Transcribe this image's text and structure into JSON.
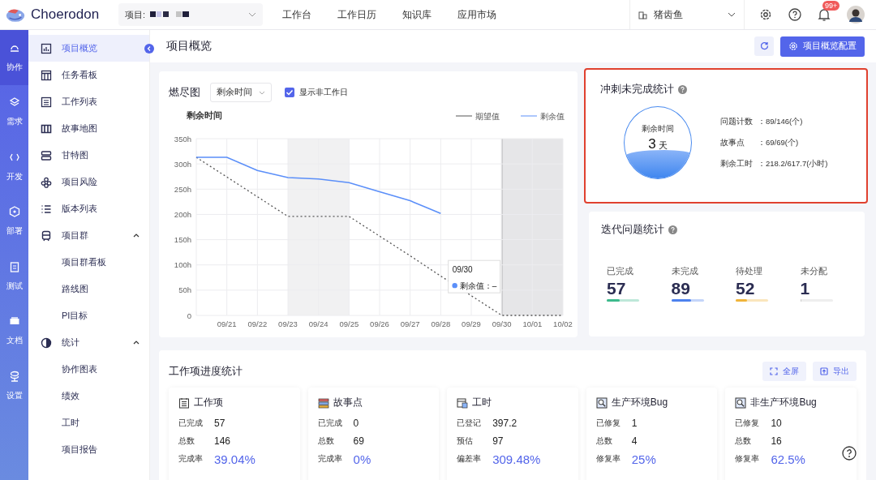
{
  "topbar": {
    "brand": "Choerodon",
    "project_label": "项目:",
    "nav": [
      {
        "label": "工作台"
      },
      {
        "label": "工作日历"
      },
      {
        "label": "知识库"
      },
      {
        "label": "应用市场"
      }
    ],
    "org": "猪齿鱼",
    "notification_count": "99+"
  },
  "rail": [
    {
      "label": "协作",
      "selected": true
    },
    {
      "label": "需求",
      "selected": false
    },
    {
      "label": "开发",
      "selected": false
    },
    {
      "label": "部署",
      "selected": false
    },
    {
      "label": "测试",
      "selected": false
    },
    {
      "label": "文档",
      "selected": false
    },
    {
      "label": "设置",
      "selected": false
    }
  ],
  "sidebar": {
    "items": [
      {
        "label": "项目概览",
        "selected": true
      },
      {
        "label": "任务看板",
        "selected": false
      },
      {
        "label": "工作列表",
        "selected": false
      },
      {
        "label": "故事地图",
        "selected": false
      },
      {
        "label": "甘特图",
        "selected": false
      },
      {
        "label": "项目风险",
        "selected": false
      },
      {
        "label": "版本列表",
        "selected": false
      },
      {
        "label": "项目群",
        "selected": false,
        "expanded": true,
        "children": [
          {
            "label": "项目群看板",
            "selected": false
          },
          {
            "label": "路线图",
            "selected": false
          },
          {
            "label": "PI目标",
            "selected": false
          }
        ]
      },
      {
        "label": "统计",
        "selected": false,
        "expanded": true,
        "children": [
          {
            "label": "协作图表",
            "selected": false
          },
          {
            "label": "绩效",
            "selected": false
          },
          {
            "label": "工时",
            "selected": false
          },
          {
            "label": "项目报告",
            "selected": false
          }
        ]
      }
    ]
  },
  "page": {
    "title": "项目概览",
    "config_button": "项目概览配置"
  },
  "burndown": {
    "title": "燃尽图",
    "select_value": "剩余时间",
    "show_nonworking": {
      "label": "显示非工作日",
      "checked": true
    },
    "chart_data": {
      "type": "line",
      "ylabel": "剩余时间",
      "categories": [
        null,
        "09/21",
        "09/22",
        "09/23",
        "09/24",
        "09/25",
        "09/26",
        "09/27",
        "09/28",
        "09/29",
        "09/30",
        "10/01",
        "10/02"
      ],
      "ylim": [
        0,
        350
      ],
      "yticks": [
        0,
        {
          "value": 50,
          "label": "50h"
        },
        {
          "value": 100,
          "label": "100h"
        },
        {
          "value": 150,
          "label": "150h"
        },
        {
          "value": 200,
          "label": "200h"
        },
        {
          "value": 250,
          "label": "250h"
        },
        {
          "value": 300,
          "label": "300h"
        },
        {
          "value": 350,
          "label": "350h"
        }
      ],
      "series": [
        {
          "name": "期望值",
          "color": "#555555",
          "line_style": "dotted",
          "values": [
            313,
            274,
            235,
            196,
            196,
            196,
            157,
            118,
            78,
            39,
            0,
            0,
            0
          ]
        },
        {
          "name": "剩余值",
          "color": "#5b8ff9",
          "line_style": "solid",
          "values": [
            313,
            313,
            287,
            273,
            270,
            263,
            245,
            227,
            202,
            null,
            null,
            null,
            null
          ]
        }
      ],
      "grid": true,
      "legend": "upper right",
      "annotations": [
        "09/30",
        "剩余值：–"
      ]
    }
  },
  "sprint_stats": {
    "title": "冲刺未完成统计",
    "gauge_label": "剩余时间",
    "gauge_value": "3",
    "gauge_unit": "天",
    "level": 0.4,
    "rows": [
      {
        "label": "问题计数",
        "value": "：89/146(个)"
      },
      {
        "label": "故事点",
        "value": "：69/69(个)"
      },
      {
        "label": "剩余工时",
        "value": "：218.2/617.7(小时)"
      }
    ]
  },
  "issue_stats": {
    "title": "迭代问题统计",
    "items": [
      {
        "label": "已完成",
        "value": "57",
        "color": "#3dba8c",
        "level": 0.39
      },
      {
        "label": "未完成",
        "value": "89",
        "color": "#4d82ee",
        "level": 0.61
      },
      {
        "label": "待处理",
        "value": "52",
        "color": "#f0b43a",
        "level": 0.36
      },
      {
        "label": "未分配",
        "value": "1",
        "color": "#cccccc",
        "level": 0.01
      }
    ]
  },
  "progress": {
    "title": "工作项进度统计",
    "buttons": [
      "全屏",
      "导出"
    ],
    "cards": [
      {
        "title": "工作项",
        "rows": [
          {
            "label": "已完成",
            "value": "57"
          },
          {
            "label": "总数",
            "value": "146"
          },
          {
            "label": "完成率",
            "value": "39.04%"
          }
        ]
      },
      {
        "title": "故事点",
        "rows": [
          {
            "label": "已完成",
            "value": "0"
          },
          {
            "label": "总数",
            "value": "69"
          },
          {
            "label": "完成率",
            "value": "0%"
          }
        ]
      },
      {
        "title": "工时",
        "rows": [
          {
            "label": "已登记",
            "value": "397.2"
          },
          {
            "label": "预估",
            "value": "97"
          },
          {
            "label": "偏差率",
            "value": "309.48%"
          }
        ]
      },
      {
        "title": "生产环境Bug",
        "rows": [
          {
            "label": "已修复",
            "value": "1"
          },
          {
            "label": "总数",
            "value": "4"
          },
          {
            "label": "修复率",
            "value": "25%"
          }
        ]
      },
      {
        "title": "非生产环境Bug",
        "rows": [
          {
            "label": "已修复",
            "value": "10"
          },
          {
            "label": "总数",
            "value": "16"
          },
          {
            "label": "修复率",
            "value": "62.5%"
          }
        ]
      }
    ]
  }
}
